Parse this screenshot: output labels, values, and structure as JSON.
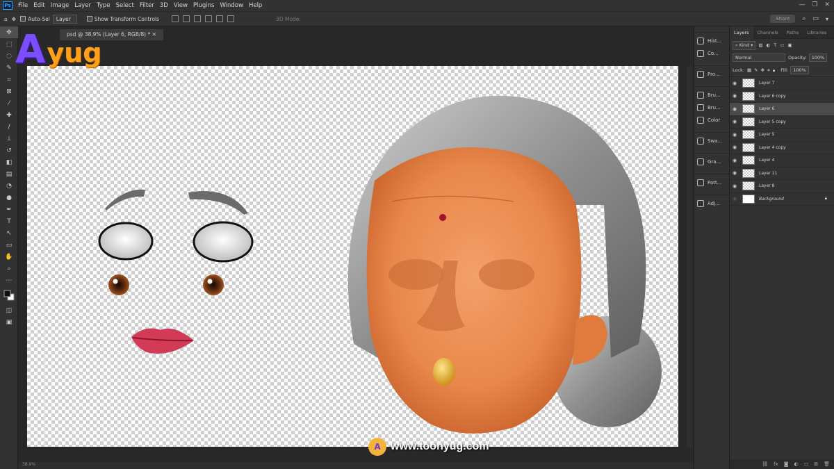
{
  "app": {
    "logo_text": "Ps",
    "menu": [
      "File",
      "Edit",
      "Image",
      "Layer",
      "Type",
      "Select",
      "Filter",
      "3D",
      "View",
      "Plugins",
      "Window",
      "Help"
    ],
    "window_controls": [
      "—",
      "❐",
      "✕"
    ]
  },
  "options_bar": {
    "auto_select_label": "Auto-Sel",
    "auto_select_target": "Layer",
    "show_transform_label": "Show Transform Controls",
    "mode_3d_label": "3D Mode:",
    "share_label": "Share"
  },
  "document": {
    "tab_title": "psd @ 38.9% (Layer 6, RGB/8) *",
    "status_text": "38.9%"
  },
  "collapsed_panels": [
    {
      "label": "Hist...",
      "icon": "history-icon"
    },
    {
      "label": "Co...",
      "icon": "comments-icon"
    },
    {
      "label": "Pro...",
      "icon": "properties-icon"
    },
    {
      "label": "Bru...",
      "icon": "brush-settings-icon"
    },
    {
      "label": "Bru...",
      "icon": "brushes-icon"
    },
    {
      "label": "Color",
      "icon": "color-icon"
    },
    {
      "label": "Swa...",
      "icon": "swatches-icon"
    },
    {
      "label": "Gra...",
      "icon": "gradients-icon"
    },
    {
      "label": "Patt...",
      "icon": "patterns-icon"
    },
    {
      "label": "Adj...",
      "icon": "adjustments-icon"
    }
  ],
  "layers_panel": {
    "tabs": [
      "Layers",
      "Channels",
      "Paths",
      "Libraries"
    ],
    "active_tab": "Layers",
    "kind_label": "Kind",
    "blend_mode": "Normal",
    "opacity_label": "Opacity:",
    "opacity_value": "100%",
    "lock_label": "Lock:",
    "fill_label": "Fill:",
    "fill_value": "100%",
    "layers": [
      {
        "name": "Layer 7",
        "selected": false
      },
      {
        "name": "Layer 6 copy",
        "selected": false
      },
      {
        "name": "Layer 6",
        "selected": true
      },
      {
        "name": "Layer 5 copy",
        "selected": false
      },
      {
        "name": "Layer 5",
        "selected": false
      },
      {
        "name": "Layer 4 copy",
        "selected": false
      },
      {
        "name": "Layer 4",
        "selected": false
      },
      {
        "name": "Layer 11",
        "selected": false
      },
      {
        "name": "Layer 8",
        "selected": false
      },
      {
        "name": "Background",
        "selected": false,
        "locked": true
      }
    ]
  },
  "watermark": {
    "brand_a": "A",
    "brand_rest": "yug",
    "url": "www.toonyug.com"
  },
  "colors": {
    "skin": "#e8874a",
    "hair": "#9a9a9a",
    "lips": "#d23a55",
    "bindi": "#a3122a",
    "brand_purple": "#7c4dff",
    "brand_orange": "#ff9f1a"
  }
}
